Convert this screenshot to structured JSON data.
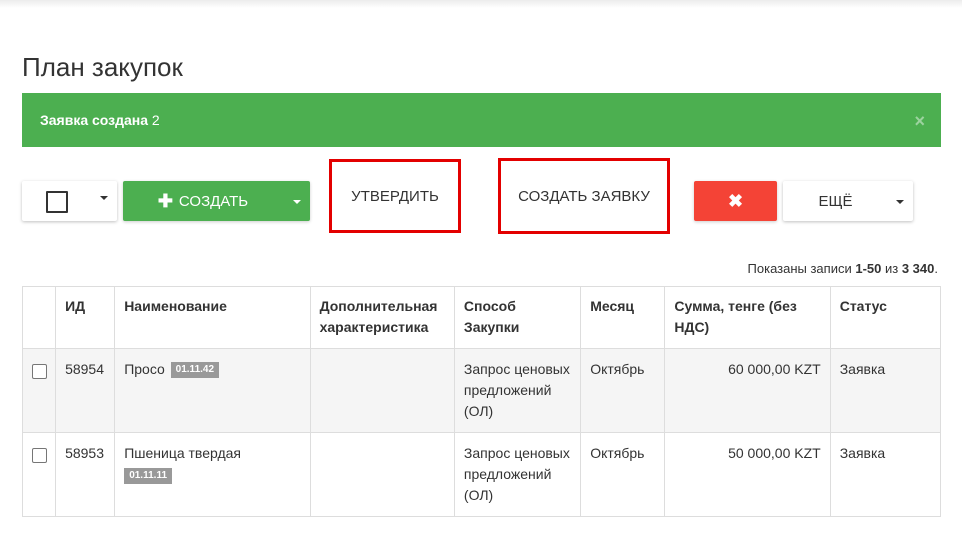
{
  "page": {
    "title": "План закупок"
  },
  "alert": {
    "bold_text": "Заявка создана",
    "text": " 2",
    "close": "×"
  },
  "toolbar": {
    "create_label": "СОЗДАТЬ",
    "approve_label": "УТВЕРДИТЬ",
    "create_request_label": "СОЗДАТЬ ЗАЯВКУ",
    "delete_icon": "✖",
    "more_label": "ЕЩЁ"
  },
  "summary": {
    "prefix": "Показаны записи ",
    "range": "1-50",
    "mid": " из ",
    "total": "3 340",
    "suffix": "."
  },
  "table": {
    "headers": [
      "ИД",
      "Наименование",
      "Дополнительная характеристика",
      "Способ Закупки",
      "Месяц",
      "Сумма, тенге (без НДС)",
      "Статус"
    ],
    "rows": [
      {
        "id": "58954",
        "name": "Просо",
        "code": "01.11.42",
        "extra": "",
        "method": "Запрос ценовых предложений (ОЛ)",
        "month": "Октябрь",
        "sum": "60 000,00 KZT",
        "status": "Заявка"
      },
      {
        "id": "58953",
        "name": "Пшеница твердая",
        "code": "01.11.11",
        "extra": "",
        "method": "Запрос ценовых предложений (ОЛ)",
        "month": "Октябрь",
        "sum": "50 000,00 KZT",
        "status": "Заявка"
      }
    ]
  },
  "colors": {
    "success": "#4caf50",
    "danger": "#f44336",
    "highlight": "#e30000"
  }
}
